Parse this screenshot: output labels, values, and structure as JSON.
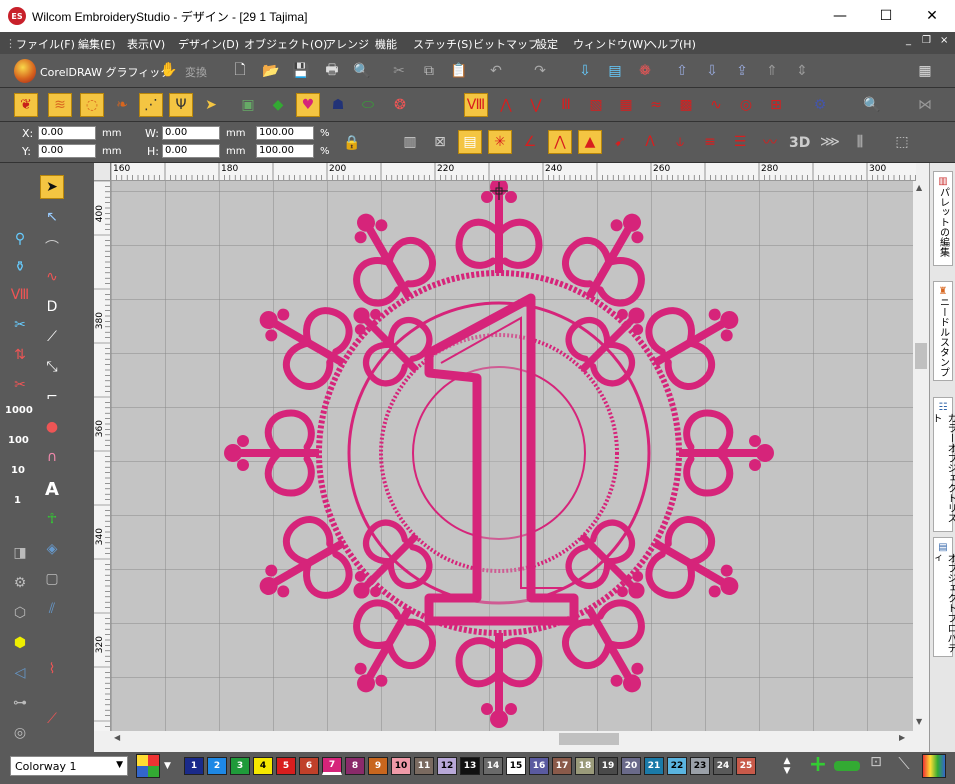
{
  "window": {
    "title": "Wilcom EmbroideryStudio - デザイン - [29 1        Tajima]",
    "logo_text": "ES",
    "minimize_icon": "minimize-icon",
    "maximize_icon": "maximize-icon",
    "close_icon": "close-icon"
  },
  "menubar": {
    "items": [
      "ファイル(F)",
      "編集(E)",
      "表示(V)",
      "デザイン(D)",
      "オブジェクト(O)",
      "アレンジ",
      "機能",
      "ステッチ(S)",
      "ビットマップ",
      "設定",
      "ウィンドウ(W)",
      "ヘルプ(H)"
    ],
    "mdi_controls": [
      "_",
      "❐",
      "×"
    ]
  },
  "toolbar1": {
    "coreldraw_label": "CorelDRAW グラフィック",
    "convert_label": "変換"
  },
  "coords": {
    "x_label": "X:",
    "y_label": "Y:",
    "w_label": "W:",
    "h_label": "H:",
    "x_value": "0.00",
    "y_value": "0.00",
    "w_value": "0.00",
    "h_value": "0.00",
    "unit_mm": "mm",
    "scale_w": "100.00",
    "scale_h": "100.00",
    "unit_pct": "%"
  },
  "toolbar3": {
    "label_3d": "3D"
  },
  "rulers": {
    "top_ticks": [
      "160",
      "180",
      "200",
      "220",
      "240",
      "260",
      "280",
      "300"
    ],
    "left_ticks": [
      "400",
      "380",
      "360",
      "340",
      "320"
    ]
  },
  "toolbox": {
    "counts": [
      "1000",
      "100",
      "10",
      "1"
    ]
  },
  "right_panel": {
    "tabs": [
      "パレットの編集",
      "ニードルスタンプ",
      "カラーオブジェクトリスト",
      "オブジェクトプロパティ"
    ]
  },
  "status": {
    "colorway": "Colorway 1",
    "swatches": [
      {
        "n": "1",
        "c": "#1a2a8a",
        "t": "#fff"
      },
      {
        "n": "2",
        "c": "#1e88e5",
        "t": "#fff"
      },
      {
        "n": "3",
        "c": "#1f9a3a",
        "t": "#fff"
      },
      {
        "n": "4",
        "c": "#f5e800",
        "t": "#000"
      },
      {
        "n": "5",
        "c": "#d81e1e",
        "t": "#fff"
      },
      {
        "n": "6",
        "c": "#c0402a",
        "t": "#fff"
      },
      {
        "n": "7",
        "c": "#d6247a",
        "t": "#fff"
      },
      {
        "n": "8",
        "c": "#8a2a6a",
        "t": "#fff"
      },
      {
        "n": "9",
        "c": "#c8661e",
        "t": "#fff"
      },
      {
        "n": "10",
        "c": "#f09aa8",
        "t": "#000"
      },
      {
        "n": "11",
        "c": "#7a6a60",
        "t": "#fff"
      },
      {
        "n": "12",
        "c": "#b8a8d8",
        "t": "#000"
      },
      {
        "n": "13",
        "c": "#111111",
        "t": "#fff"
      },
      {
        "n": "14",
        "c": "#6a6a6a",
        "t": "#fff"
      },
      {
        "n": "15",
        "c": "#ffffff",
        "t": "#000"
      },
      {
        "n": "16",
        "c": "#5a5aa0",
        "t": "#fff"
      },
      {
        "n": "17",
        "c": "#8a5a4a",
        "t": "#fff"
      },
      {
        "n": "18",
        "c": "#9a9a7a",
        "t": "#fff"
      },
      {
        "n": "19",
        "c": "#4a4a4a",
        "t": "#fff"
      },
      {
        "n": "20",
        "c": "#6a6a8a",
        "t": "#fff"
      },
      {
        "n": "21",
        "c": "#1a7aa8",
        "t": "#fff"
      },
      {
        "n": "22",
        "c": "#5ab4e0",
        "t": "#000"
      },
      {
        "n": "23",
        "c": "#9aa0a8",
        "t": "#000"
      },
      {
        "n": "24",
        "c": "#5a5a5a",
        "t": "#fff"
      },
      {
        "n": "25",
        "c": "#c85a4a",
        "t": "#fff"
      }
    ]
  },
  "colors": {
    "accent": "#f4c542",
    "embroidery": "#d6247a",
    "toolbar": "#5a5a5a",
    "canvas": "#c8c8c8"
  }
}
